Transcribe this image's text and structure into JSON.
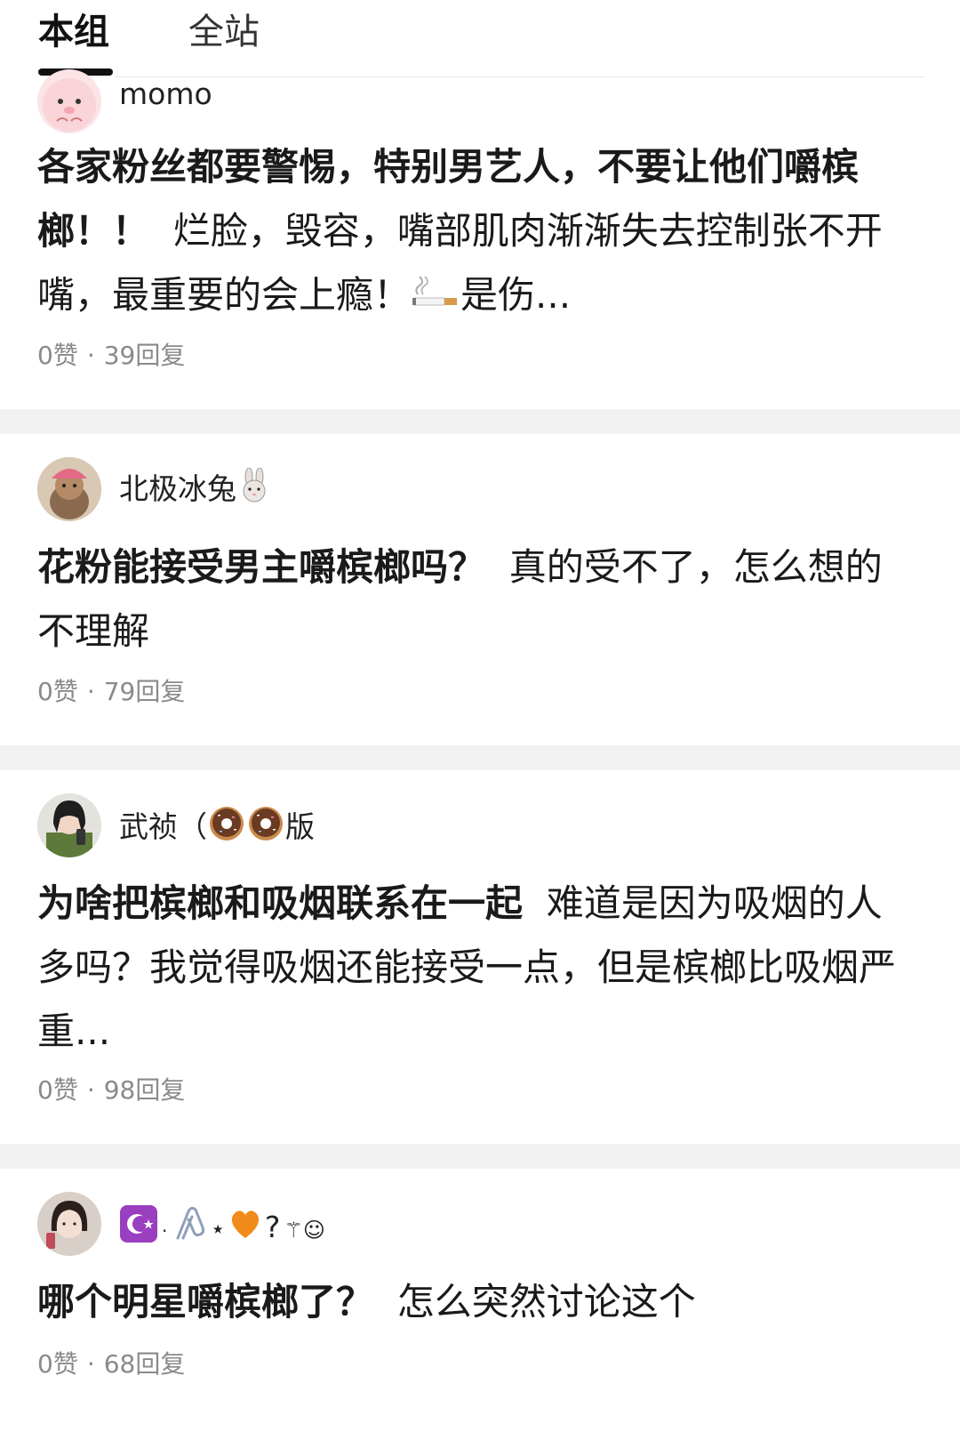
{
  "tabs": {
    "active": "本组",
    "inactive": "全站"
  },
  "posts": [
    {
      "author": "momo",
      "title": "各家粉丝都要警惕，特别男艺人，不要让他们嚼槟榔！！",
      "body": "烂脸，毁容，嘴部肌肉渐渐失去控制张不开嘴，最重要的会上瘾！",
      "body_tail": "是伤...",
      "likes": "0赞",
      "replies": "39回复"
    },
    {
      "author": "北极冰兔",
      "title": "花粉能接受男主嚼槟榔吗？",
      "body": "真的受不了，怎么想的不理解",
      "likes": "0赞",
      "replies": "79回复"
    },
    {
      "author": "武祯（",
      "author_tail": "版",
      "title": "为啥把槟榔和吸烟联系在一起",
      "body": "难道是因为吸烟的人多吗？我觉得吸烟还能接受一点，但是槟榔比吸烟严重...",
      "likes": "0赞",
      "replies": "98回复"
    },
    {
      "author": "?",
      "title": "哪个明星嚼槟榔了？",
      "body": "怎么突然讨论这个",
      "likes": "0赞",
      "replies": "68回复"
    }
  ],
  "meta_separator": "·",
  "icons": [
    "pig-avatar",
    "cigarette-emoji",
    "rabbit-emoji",
    "donut-emoji",
    "star-and-crescent-emoji",
    "paperclip-emoji",
    "orange-heart-emoji"
  ]
}
